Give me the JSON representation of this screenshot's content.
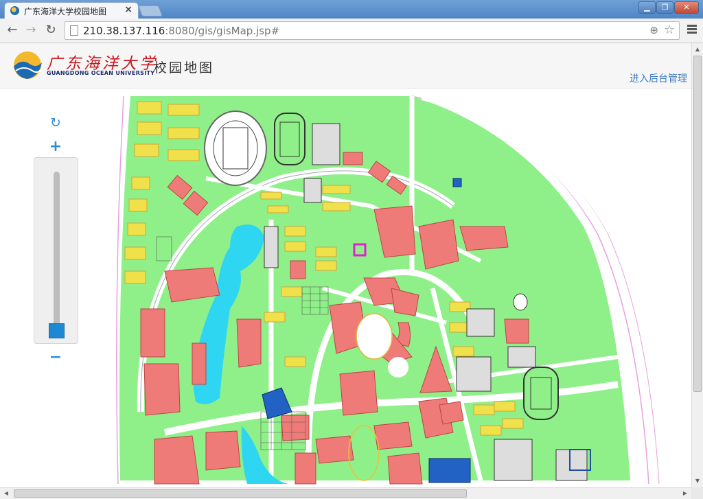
{
  "browser": {
    "tab_title": "广东海洋大学校园地图",
    "tab_close": "×",
    "window_buttons": {
      "minimize": "▁",
      "maximize": "❐",
      "close": "✕"
    },
    "nav": {
      "back": "←",
      "forward": "→",
      "reload": "↻"
    },
    "url_host": "210.38.137.116",
    "url_path": ":8080/gis/gisMap.jsp#",
    "icons": [
      "page-icon",
      "zoom-icon",
      "star-icon",
      "menu-icon"
    ]
  },
  "header": {
    "logo_cn": "广东海洋大学",
    "logo_en": "GUANGDONG OCEAN UNIVERSITY",
    "title": "校园地图",
    "admin_link": "进入后台管理"
  },
  "map_controls": {
    "refresh": "↻",
    "zoom_in": "+",
    "zoom_out": "−",
    "zoom_level_fraction": 0.0
  },
  "colors": {
    "accent": "#2f8fd3",
    "grass": "#8ff08a",
    "building": "#ee7b78",
    "water": "#2ed6f2",
    "road": "#ffffff",
    "field_yellow": "#f0e04a",
    "link": "#3d7bbf"
  }
}
